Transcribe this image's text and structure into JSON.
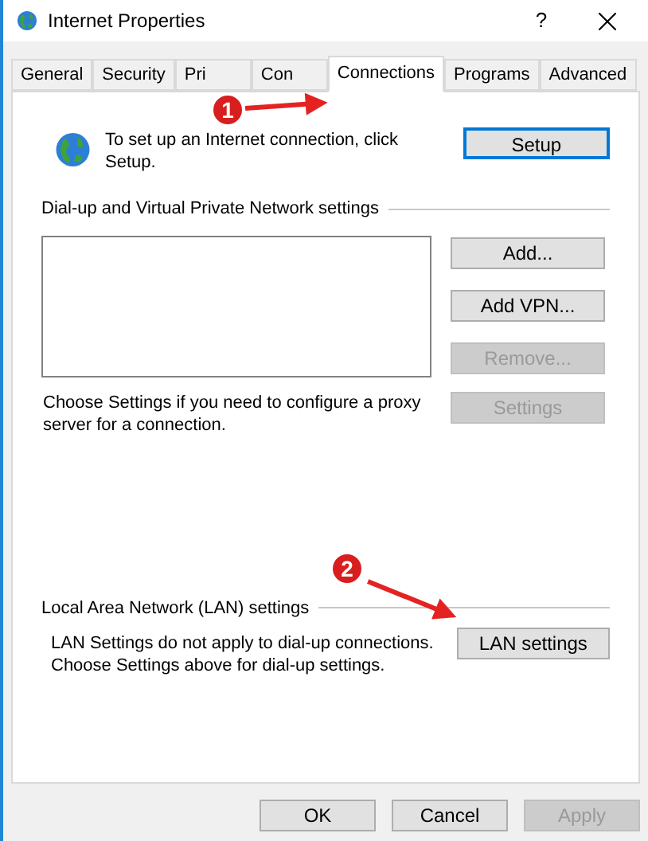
{
  "window": {
    "title": "Internet Properties",
    "help": "?"
  },
  "tabs": [
    {
      "label": "General",
      "selected": false
    },
    {
      "label": "Security",
      "selected": false
    },
    {
      "label": "Pri",
      "selected": false
    },
    {
      "label": "Con",
      "selected": false
    },
    {
      "label": "Connections",
      "selected": true
    },
    {
      "label": "Programs",
      "selected": false
    },
    {
      "label": "Advanced",
      "selected": false
    }
  ],
  "setup": {
    "text": "To set up an Internet connection, click Setup.",
    "button": "Setup"
  },
  "dialup": {
    "heading": "Dial-up and Virtual Private Network settings",
    "buttons": [
      {
        "label": "Add...",
        "disabled": false
      },
      {
        "label": "Add VPN...",
        "disabled": false
      },
      {
        "label": "Remove...",
        "disabled": true
      }
    ],
    "proxy_text": "Choose Settings if you need to configure a proxy server for a connection.",
    "settings_button": {
      "label": "Settings",
      "disabled": true
    }
  },
  "lan": {
    "heading": "Local Area Network (LAN) settings",
    "text": "LAN Settings do not apply to dial-up connections. Choose Settings above for dial-up settings.",
    "button": "LAN settings"
  },
  "annotations": [
    {
      "number": "1"
    },
    {
      "number": "2"
    }
  ],
  "buttons": [
    {
      "label": "OK",
      "disabled": false
    },
    {
      "label": "Cancel",
      "disabled": false
    },
    {
      "label": "Apply",
      "disabled": true
    }
  ]
}
